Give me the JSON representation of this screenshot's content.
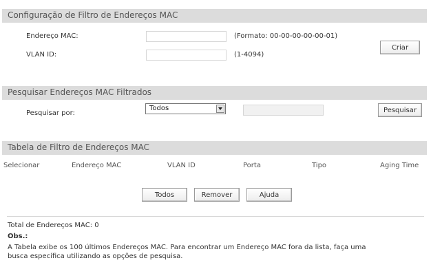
{
  "config": {
    "title": "Configuração de Filtro de Endereços MAC",
    "mac_label": "Endereço MAC:",
    "mac_value": "",
    "mac_hint": "(Formato: 00-00-00-00-00-01)",
    "vlan_label": "VLAN ID:",
    "vlan_value": "",
    "vlan_hint": "(1-4094)",
    "create_button": "Criar"
  },
  "search": {
    "title": "Pesquisar Endereços MAC Filtrados",
    "by_label": "Pesquisar por:",
    "select_value": "Todos",
    "query_value": "",
    "search_button": "Pesquisar"
  },
  "table": {
    "title": "Tabela de Filtro de Endereços MAC",
    "columns": [
      "Selecionar",
      "Endereço MAC",
      "VLAN ID",
      "Porta",
      "Tipo",
      "Aging Time"
    ],
    "rows": []
  },
  "actions": {
    "all_button": "Todos",
    "remove_button": "Remover",
    "help_button": "Ajuda"
  },
  "footer": {
    "total_label": "Total de Endereços MAC: 0",
    "obs_label": "Obs.:",
    "note_line1": "A Tabela exibe os 100 últimos Endereços MAC. Para encontrar um Endereço MAC fora da lista, faça uma",
    "note_line2": "busca específica utilizando as opções de pesquisa."
  },
  "icons": {
    "select_arrow": "chevron-down-icon"
  }
}
